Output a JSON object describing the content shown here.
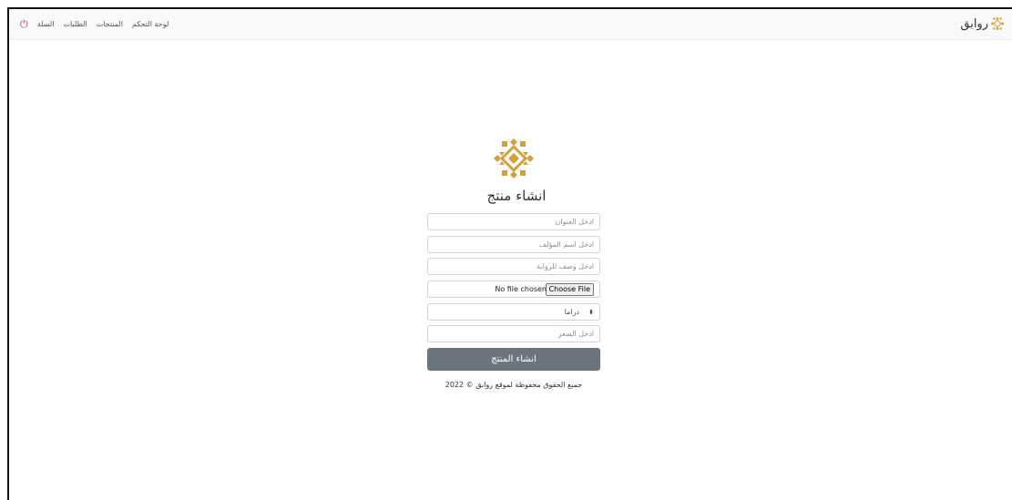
{
  "navbar": {
    "brand": "روابق",
    "links": [
      "لوحة التحكم",
      "المنتجات",
      "الطلبات",
      "السلة"
    ],
    "logout_icon": "power-icon"
  },
  "form": {
    "logo_icon": "diamond-ornament-logo",
    "title": "انشاء منتج",
    "title_placeholder": "ادخل العنوان",
    "author_placeholder": "ادخل اسم المؤلف",
    "description_placeholder": "ادخل وصف للرواية",
    "file_button": "Choose File",
    "file_status": "No file chosen",
    "category_selected": "دراما",
    "price_placeholder": "ادخل السعر",
    "submit_label": "انشاء المنتج"
  },
  "footer": {
    "copyright": "جميع الحقوق محفوظة لموقع روابق © 2022"
  },
  "colors": {
    "accent_gold": "#d4a139",
    "button_gray": "#6c757d",
    "logout_red": "#dc3545",
    "navbar_bg": "#f8f9fa"
  }
}
